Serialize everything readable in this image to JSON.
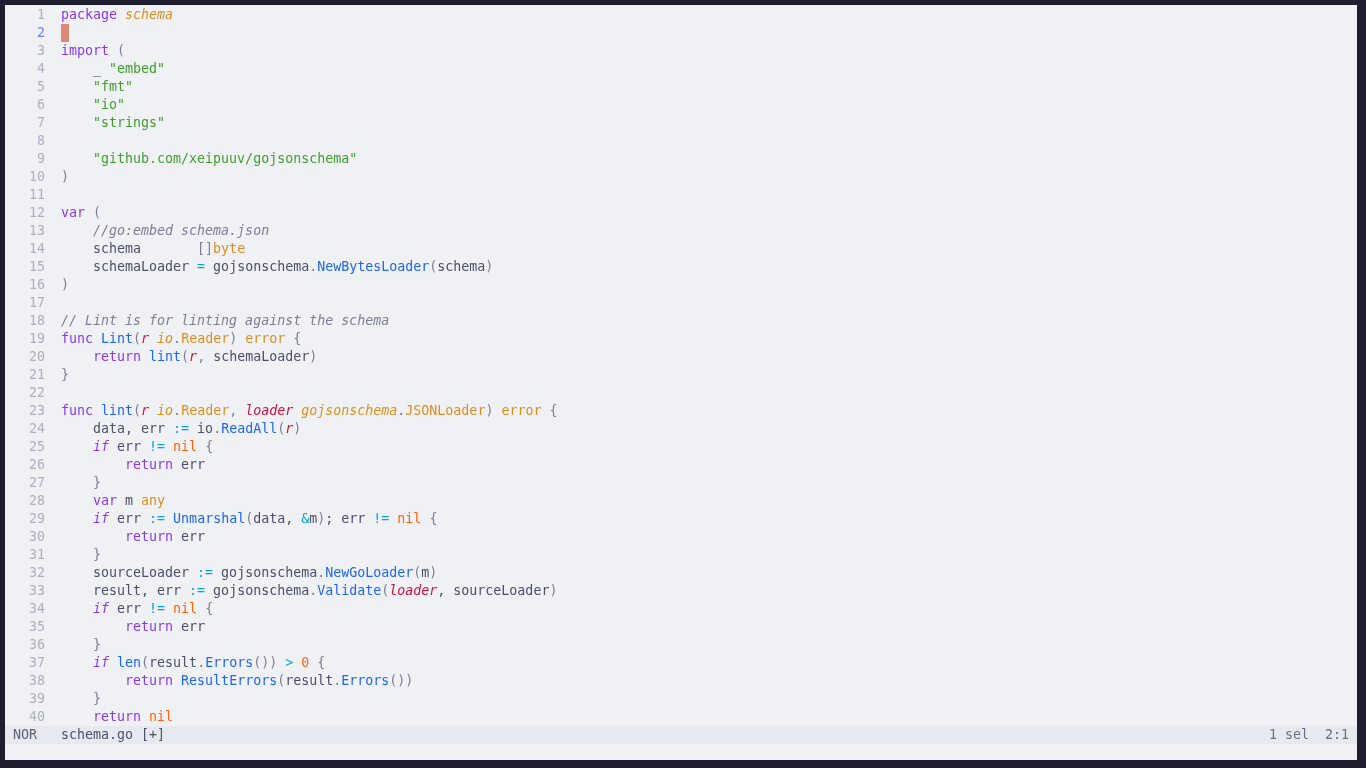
{
  "editor": {
    "lines": [
      {
        "number": "1",
        "current": false,
        "tokens": [
          {
            "kind": "keyword",
            "text": "package "
          },
          {
            "kind": "namespace",
            "text": "schema"
          }
        ]
      },
      {
        "number": "2",
        "current": true
      },
      {
        "number": "3",
        "current": false,
        "tokens": [
          {
            "kind": "keyword",
            "text": "import "
          },
          {
            "kind": "punct",
            "text": "("
          }
        ]
      },
      {
        "number": "4",
        "current": false,
        "tokens": [
          {
            "kind": "plain",
            "text": "    _ "
          },
          {
            "kind": "string",
            "text": "\"embed\""
          }
        ]
      },
      {
        "number": "5",
        "current": false,
        "tokens": [
          {
            "kind": "string",
            "text": "    \"fmt\""
          }
        ]
      },
      {
        "number": "6",
        "current": false,
        "tokens": [
          {
            "kind": "string",
            "text": "    \"io\""
          }
        ]
      },
      {
        "number": "7",
        "current": false,
        "tokens": [
          {
            "kind": "string",
            "text": "    \"strings\""
          }
        ]
      },
      {
        "number": "8",
        "current": false
      },
      {
        "number": "9",
        "current": false,
        "tokens": [
          {
            "kind": "string",
            "text": "    \"github.com/xeipuuv/gojsonschema\""
          }
        ]
      },
      {
        "number": "10",
        "current": false,
        "tokens": [
          {
            "kind": "punct",
            "text": ")"
          }
        ]
      },
      {
        "number": "11",
        "current": false
      },
      {
        "number": "12",
        "current": false,
        "tokens": [
          {
            "kind": "keyword",
            "text": "var "
          },
          {
            "kind": "punct",
            "text": "("
          }
        ]
      },
      {
        "number": "13",
        "current": false,
        "tokens": [
          {
            "kind": "comment",
            "text": "    //go:embed schema.json"
          }
        ]
      },
      {
        "number": "14",
        "current": false,
        "tokens": [
          {
            "kind": "plain",
            "text": "    schema       "
          },
          {
            "kind": "punct",
            "text": "[]"
          },
          {
            "kind": "type",
            "text": "byte"
          }
        ]
      },
      {
        "number": "15",
        "current": false,
        "tokens": [
          {
            "kind": "plain",
            "text": "    schemaLoader "
          },
          {
            "kind": "operator",
            "text": "="
          },
          {
            "kind": "plain",
            "text": " gojsonschema"
          },
          {
            "kind": "punct",
            "text": "."
          },
          {
            "kind": "function",
            "text": "NewBytesLoader"
          },
          {
            "kind": "punct",
            "text": "("
          },
          {
            "kind": "plain",
            "text": "schema"
          },
          {
            "kind": "punct",
            "text": ")"
          }
        ]
      },
      {
        "number": "16",
        "current": false,
        "tokens": [
          {
            "kind": "punct",
            "text": ")"
          }
        ]
      },
      {
        "number": "17",
        "current": false
      },
      {
        "number": "18",
        "current": false,
        "tokens": [
          {
            "kind": "comment",
            "text": "// Lint is for linting against the schema"
          }
        ]
      },
      {
        "number": "19",
        "current": false,
        "tokens": [
          {
            "kind": "keyword",
            "text": "func "
          },
          {
            "kind": "function",
            "text": "Lint"
          },
          {
            "kind": "punct",
            "text": "("
          },
          {
            "kind": "param",
            "text": "r "
          },
          {
            "kind": "namespace",
            "text": "io"
          },
          {
            "kind": "punct",
            "text": "."
          },
          {
            "kind": "type",
            "text": "Reader"
          },
          {
            "kind": "punct",
            "text": ") "
          },
          {
            "kind": "type",
            "text": "error "
          },
          {
            "kind": "punct",
            "text": "{"
          }
        ]
      },
      {
        "number": "20",
        "current": false,
        "tokens": [
          {
            "kind": "keyword",
            "text": "    return "
          },
          {
            "kind": "function",
            "text": "lint"
          },
          {
            "kind": "punct",
            "text": "("
          },
          {
            "kind": "param",
            "text": "r"
          },
          {
            "kind": "punct",
            "text": ","
          },
          {
            "kind": "plain",
            "text": " schemaLoader"
          },
          {
            "kind": "punct",
            "text": ")"
          }
        ]
      },
      {
        "number": "21",
        "current": false,
        "tokens": [
          {
            "kind": "punct",
            "text": "}"
          }
        ]
      },
      {
        "number": "22",
        "current": false
      },
      {
        "number": "23",
        "current": false,
        "tokens": [
          {
            "kind": "keyword",
            "text": "func "
          },
          {
            "kind": "function",
            "text": "lint"
          },
          {
            "kind": "punct",
            "text": "("
          },
          {
            "kind": "param",
            "text": "r "
          },
          {
            "kind": "namespace",
            "text": "io"
          },
          {
            "kind": "punct",
            "text": "."
          },
          {
            "kind": "type",
            "text": "Reader"
          },
          {
            "kind": "punct",
            "text": ", "
          },
          {
            "kind": "param",
            "text": "loader "
          },
          {
            "kind": "namespace",
            "text": "gojsonschema"
          },
          {
            "kind": "punct",
            "text": "."
          },
          {
            "kind": "type",
            "text": "JSONLoader"
          },
          {
            "kind": "punct",
            "text": ") "
          },
          {
            "kind": "type",
            "text": "error "
          },
          {
            "kind": "punct",
            "text": "{"
          }
        ]
      },
      {
        "number": "24",
        "current": false,
        "tokens": [
          {
            "kind": "plain",
            "text": "    data, err "
          },
          {
            "kind": "operator",
            "text": ":="
          },
          {
            "kind": "plain",
            "text": " io"
          },
          {
            "kind": "punct",
            "text": "."
          },
          {
            "kind": "function",
            "text": "ReadAll"
          },
          {
            "kind": "punct",
            "text": "("
          },
          {
            "kind": "param",
            "text": "r"
          },
          {
            "kind": "punct",
            "text": ")"
          }
        ]
      },
      {
        "number": "25",
        "current": false,
        "tokens": [
          {
            "kind": "keyword-italic",
            "text": "    if"
          },
          {
            "kind": "plain",
            "text": " err "
          },
          {
            "kind": "operator",
            "text": "!= "
          },
          {
            "kind": "constant",
            "text": "nil "
          },
          {
            "kind": "punct",
            "text": "{"
          }
        ]
      },
      {
        "number": "26",
        "current": false,
        "tokens": [
          {
            "kind": "keyword",
            "text": "        return"
          },
          {
            "kind": "plain",
            "text": " err"
          }
        ]
      },
      {
        "number": "27",
        "current": false,
        "tokens": [
          {
            "kind": "punct",
            "text": "    }"
          }
        ]
      },
      {
        "number": "28",
        "current": false,
        "tokens": [
          {
            "kind": "keyword",
            "text": "    var"
          },
          {
            "kind": "plain",
            "text": " m "
          },
          {
            "kind": "type",
            "text": "any"
          }
        ]
      },
      {
        "number": "29",
        "current": false,
        "tokens": [
          {
            "kind": "keyword-italic",
            "text": "    if"
          },
          {
            "kind": "plain",
            "text": " err "
          },
          {
            "kind": "operator",
            "text": ":= "
          },
          {
            "kind": "function",
            "text": "Unmarshal"
          },
          {
            "kind": "punct",
            "text": "("
          },
          {
            "kind": "plain",
            "text": "data, "
          },
          {
            "kind": "operator",
            "text": "&"
          },
          {
            "kind": "plain",
            "text": "m"
          },
          {
            "kind": "punct",
            "text": ")"
          },
          {
            "kind": "plain",
            "text": "; err "
          },
          {
            "kind": "operator",
            "text": "!= "
          },
          {
            "kind": "constant",
            "text": "nil "
          },
          {
            "kind": "punct",
            "text": "{"
          }
        ]
      },
      {
        "number": "30",
        "current": false,
        "tokens": [
          {
            "kind": "keyword",
            "text": "        return"
          },
          {
            "kind": "plain",
            "text": " err"
          }
        ]
      },
      {
        "number": "31",
        "current": false,
        "tokens": [
          {
            "kind": "punct",
            "text": "    }"
          }
        ]
      },
      {
        "number": "32",
        "current": false,
        "tokens": [
          {
            "kind": "plain",
            "text": "    sourceLoader "
          },
          {
            "kind": "operator",
            "text": ":="
          },
          {
            "kind": "plain",
            "text": " gojsonschema"
          },
          {
            "kind": "punct",
            "text": "."
          },
          {
            "kind": "function",
            "text": "NewGoLoader"
          },
          {
            "kind": "punct",
            "text": "("
          },
          {
            "kind": "plain",
            "text": "m"
          },
          {
            "kind": "punct",
            "text": ")"
          }
        ]
      },
      {
        "number": "33",
        "current": false,
        "tokens": [
          {
            "kind": "plain",
            "text": "    result, err "
          },
          {
            "kind": "operator",
            "text": ":="
          },
          {
            "kind": "plain",
            "text": " gojsonschema"
          },
          {
            "kind": "punct",
            "text": "."
          },
          {
            "kind": "function",
            "text": "Validate"
          },
          {
            "kind": "punct",
            "text": "("
          },
          {
            "kind": "param",
            "text": "loader"
          },
          {
            "kind": "plain",
            "text": ", sourceLoader"
          },
          {
            "kind": "punct",
            "text": ")"
          }
        ]
      },
      {
        "number": "34",
        "current": false,
        "tokens": [
          {
            "kind": "keyword-italic",
            "text": "    if"
          },
          {
            "kind": "plain",
            "text": " err "
          },
          {
            "kind": "operator",
            "text": "!= "
          },
          {
            "kind": "constant",
            "text": "nil "
          },
          {
            "kind": "punct",
            "text": "{"
          }
        ]
      },
      {
        "number": "35",
        "current": false,
        "tokens": [
          {
            "kind": "keyword",
            "text": "        return"
          },
          {
            "kind": "plain",
            "text": " err"
          }
        ]
      },
      {
        "number": "36",
        "current": false,
        "tokens": [
          {
            "kind": "punct",
            "text": "    }"
          }
        ]
      },
      {
        "number": "37",
        "current": false,
        "tokens": [
          {
            "kind": "keyword-italic",
            "text": "    if "
          },
          {
            "kind": "function",
            "text": "len"
          },
          {
            "kind": "punct",
            "text": "("
          },
          {
            "kind": "plain",
            "text": "result"
          },
          {
            "kind": "punct",
            "text": "."
          },
          {
            "kind": "function",
            "text": "Errors"
          },
          {
            "kind": "punct",
            "text": "()) "
          },
          {
            "kind": "operator",
            "text": "> "
          },
          {
            "kind": "constant",
            "text": "0 "
          },
          {
            "kind": "punct",
            "text": "{"
          }
        ]
      },
      {
        "number": "38",
        "current": false,
        "tokens": [
          {
            "kind": "keyword",
            "text": "        return "
          },
          {
            "kind": "function",
            "text": "ResultErrors"
          },
          {
            "kind": "punct",
            "text": "("
          },
          {
            "kind": "plain",
            "text": "result"
          },
          {
            "kind": "punct",
            "text": "."
          },
          {
            "kind": "function",
            "text": "Errors"
          },
          {
            "kind": "punct",
            "text": "())"
          }
        ]
      },
      {
        "number": "39",
        "current": false,
        "tokens": [
          {
            "kind": "punct",
            "text": "    }"
          }
        ]
      },
      {
        "number": "40",
        "current": false,
        "tokens": [
          {
            "kind": "keyword",
            "text": "    return "
          },
          {
            "kind": "constant",
            "text": "nil"
          }
        ]
      }
    ]
  },
  "status_bar": {
    "mode": "NOR",
    "file": "schema.go",
    "modified": "[+]",
    "selections": "1 sel",
    "position": "2:1"
  }
}
